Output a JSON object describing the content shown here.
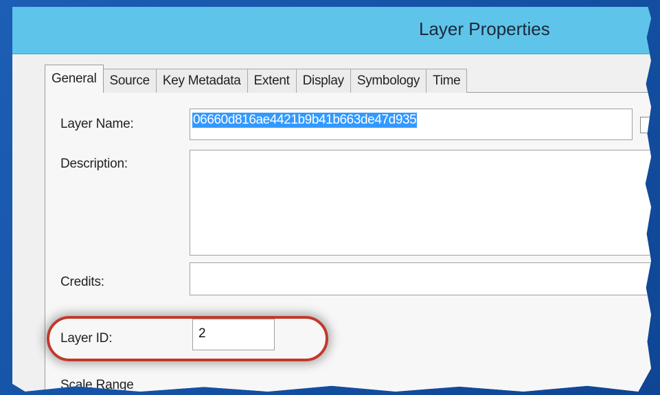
{
  "window": {
    "title": "Layer Properties"
  },
  "tabs": [
    {
      "label": "General",
      "active": true
    },
    {
      "label": "Source"
    },
    {
      "label": "Key Metadata"
    },
    {
      "label": "Extent"
    },
    {
      "label": "Display"
    },
    {
      "label": "Symbology"
    },
    {
      "label": "Time"
    }
  ],
  "general": {
    "layer_name_label": "Layer Name:",
    "layer_name_value": "06660d816ae4421b9b41b663de47d935",
    "description_label": "Description:",
    "description_value": "",
    "credits_label": "Credits:",
    "credits_value": "",
    "layer_id_label": "Layer ID:",
    "layer_id_value": "2",
    "scale_range_label": "Scale Range"
  },
  "colors": {
    "background": "#1450a3",
    "titlebar": "#5ec4ea",
    "selection": "#3399ff",
    "highlight_ring": "#c0392b"
  }
}
